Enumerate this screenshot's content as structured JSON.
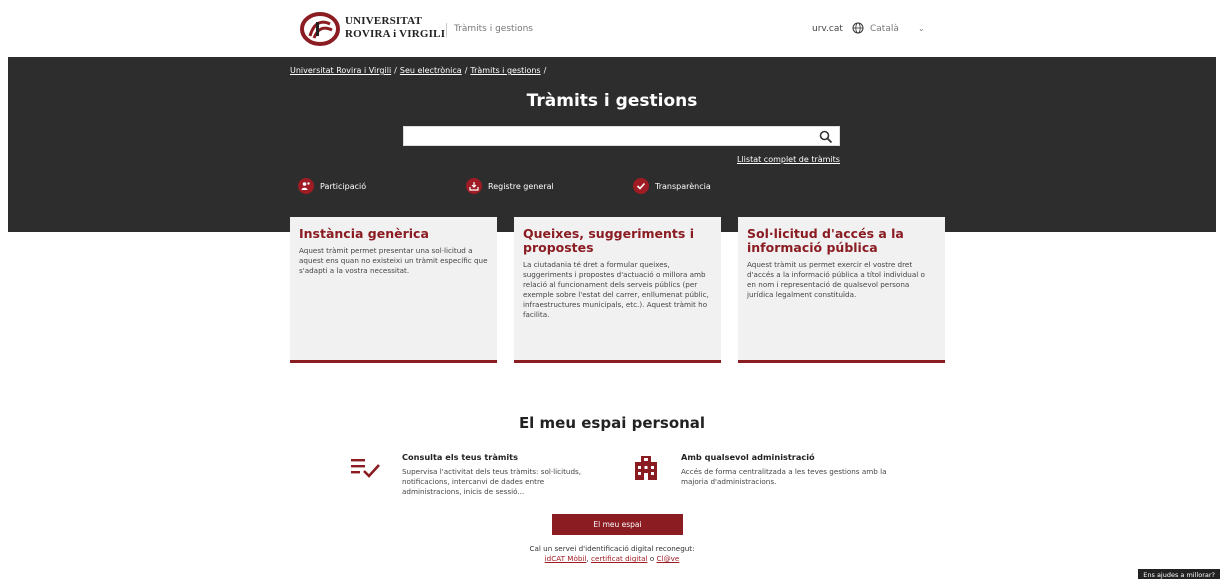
{
  "header": {
    "university_line1": "UNIVERSITAT",
    "university_line2": "ROVIRA i VIRGILI",
    "section": "Tràmits i gestions",
    "urv_link": "urv.cat",
    "language": "Català"
  },
  "breadcrumb": {
    "items": [
      "Universitat Rovira i Virgili",
      "Seu electrònica",
      "Tràmits i gestions"
    ],
    "separator": "/"
  },
  "page": {
    "title": "Tràmits i gestions",
    "full_list_link": "Llistat complet de tràmits"
  },
  "quick_links": [
    {
      "label": "Participació",
      "icon": "participation-icon"
    },
    {
      "label": "Registre general",
      "icon": "download-tray-icon"
    },
    {
      "label": "Transparència",
      "icon": "checkmark-icon"
    }
  ],
  "cards": [
    {
      "title": "Instància genèrica",
      "text": "Aquest tràmit permet presentar una sol·licitud a aquest ens quan no existeixi un tràmit específic que s'adapti a la vostra necessitat."
    },
    {
      "title": "Queixes, suggeriments i propostes",
      "text": "La ciutadania té dret a formular queixes, suggeriments i propostes d'actuació o millora amb relació al funcionament dels serveis públics (per exemple sobre l'estat del carrer, enllumenat públic, infraestructures municipals, etc.). Aquest tràmit ho facilita."
    },
    {
      "title": "Sol·licitud d'accés a la informació pública",
      "text": "Aquest tràmit us permet exercir el vostre dret d'accés a la informació pública a títol individual o en nom i representació de qualsevol persona jurídica legalment constituïda."
    }
  ],
  "personal_space": {
    "title": "El meu espai personal",
    "items": [
      {
        "title": "Consulta els teus tràmits",
        "text": "Supervisa l'activitat dels teus tràmits: sol·licituds, notificacions, intercanvi de dades entre administracions, inicis de sessió..."
      },
      {
        "title": "Amb qualsevol administració",
        "text": "Accés de forma centralitzada a les teves gestions amb la majoria d'administracions."
      }
    ],
    "button": "El meu espai",
    "ident_text": "Cal un servei d'identificació digital reconegut:",
    "ident_link1": "idCAT Mòbil",
    "ident_link2": "certificat digital",
    "ident_or": "o",
    "ident_link3": "Cl@ve"
  },
  "feedback": "Ens ajudes a millorar?",
  "colors": {
    "brand": "#8a1c22",
    "banner": "#2d2d2d",
    "card_bg": "#f1f1f1"
  }
}
